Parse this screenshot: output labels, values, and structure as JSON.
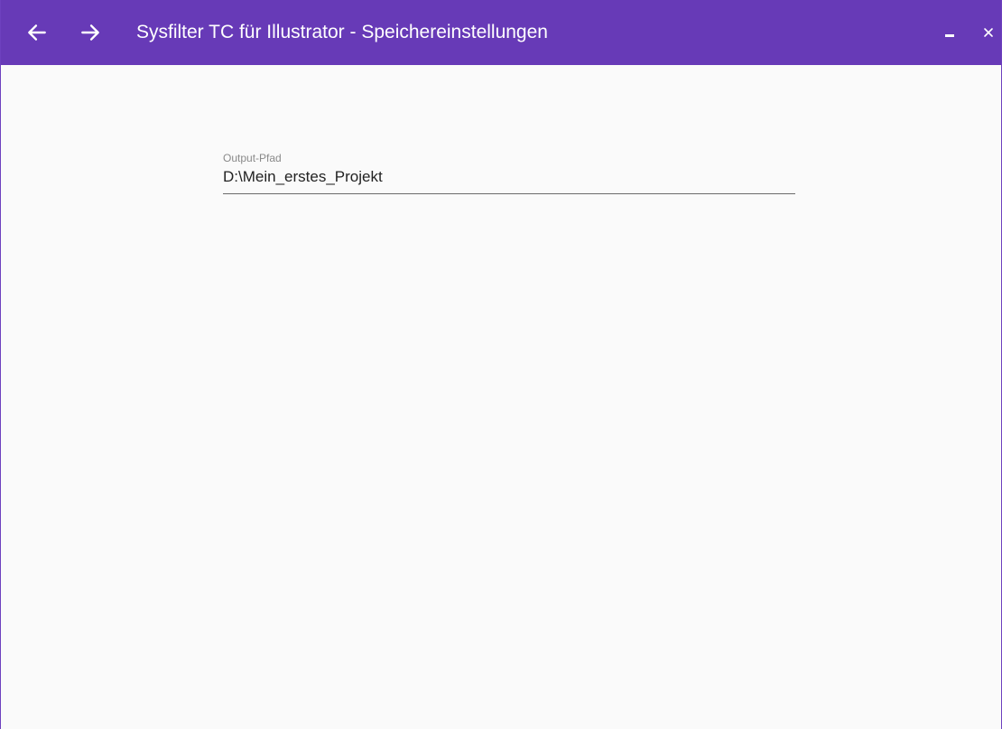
{
  "window": {
    "title": "Sysfilter TC für Illustrator - Speichereinstellungen",
    "accent_color": "#673ab7",
    "background_color": "#fafafa"
  },
  "titlebar": {
    "back_icon": "arrow-left-icon",
    "forward_icon": "arrow-right-icon",
    "minimize_icon": "minimize-icon",
    "close_icon": "close-icon"
  },
  "form": {
    "output_path": {
      "label": "Output-Pfad",
      "value": "D:\\Mein_erstes_Projekt"
    }
  }
}
